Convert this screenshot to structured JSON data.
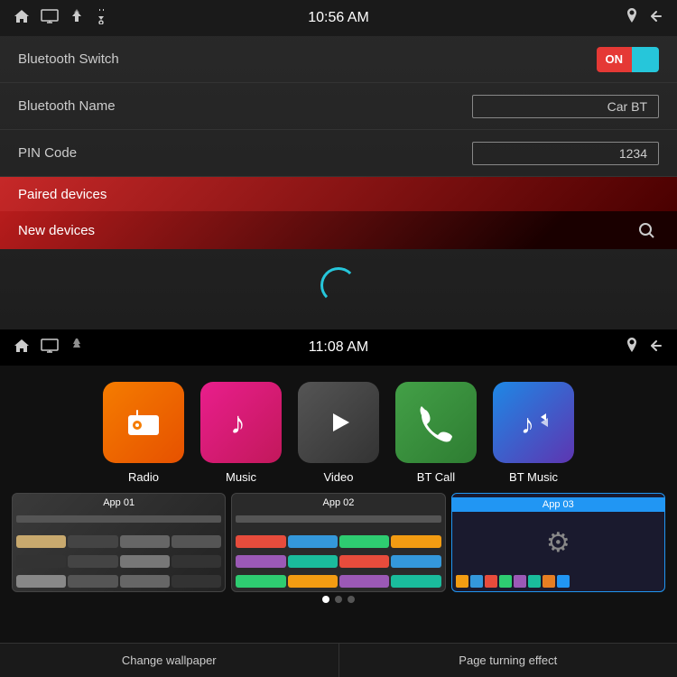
{
  "top": {
    "statusBar": {
      "time": "10:56 AM",
      "icons": [
        "home",
        "display",
        "up-arrows",
        "usb",
        "location",
        "back"
      ]
    },
    "settings": [
      {
        "label": "Bluetooth Switch",
        "type": "toggle",
        "value": "ON"
      },
      {
        "label": "Bluetooth Name",
        "type": "input",
        "value": "Car BT"
      },
      {
        "label": "PIN Code",
        "type": "input",
        "value": "1234"
      }
    ],
    "sections": [
      {
        "label": "Paired devices"
      },
      {
        "label": "New devices"
      }
    ]
  },
  "bottom": {
    "statusBar": {
      "time": "11:08 AM",
      "icons": [
        "home",
        "display",
        "up-arrows",
        "location",
        "back"
      ]
    },
    "apps": [
      {
        "id": "radio",
        "label": "Radio",
        "icon": "📻",
        "color": "radio"
      },
      {
        "id": "music",
        "label": "Music",
        "icon": "♪",
        "color": "music"
      },
      {
        "id": "video",
        "label": "Video",
        "icon": "▶",
        "color": "video"
      },
      {
        "id": "bt-call",
        "label": "BT Call",
        "icon": "📞",
        "color": "bt-call"
      },
      {
        "id": "bt-music",
        "label": "BT Music",
        "icon": "♪",
        "color": "bt-music"
      }
    ],
    "thumbnails": [
      {
        "id": "app01",
        "label": "App 01",
        "active": false
      },
      {
        "id": "app02",
        "label": "App 02",
        "active": false
      },
      {
        "id": "app03",
        "label": "App 03",
        "active": true
      }
    ],
    "dots": [
      true,
      false,
      false
    ],
    "bottomBar": [
      {
        "label": "Change wallpaper"
      },
      {
        "label": "Page turning effect"
      }
    ]
  }
}
